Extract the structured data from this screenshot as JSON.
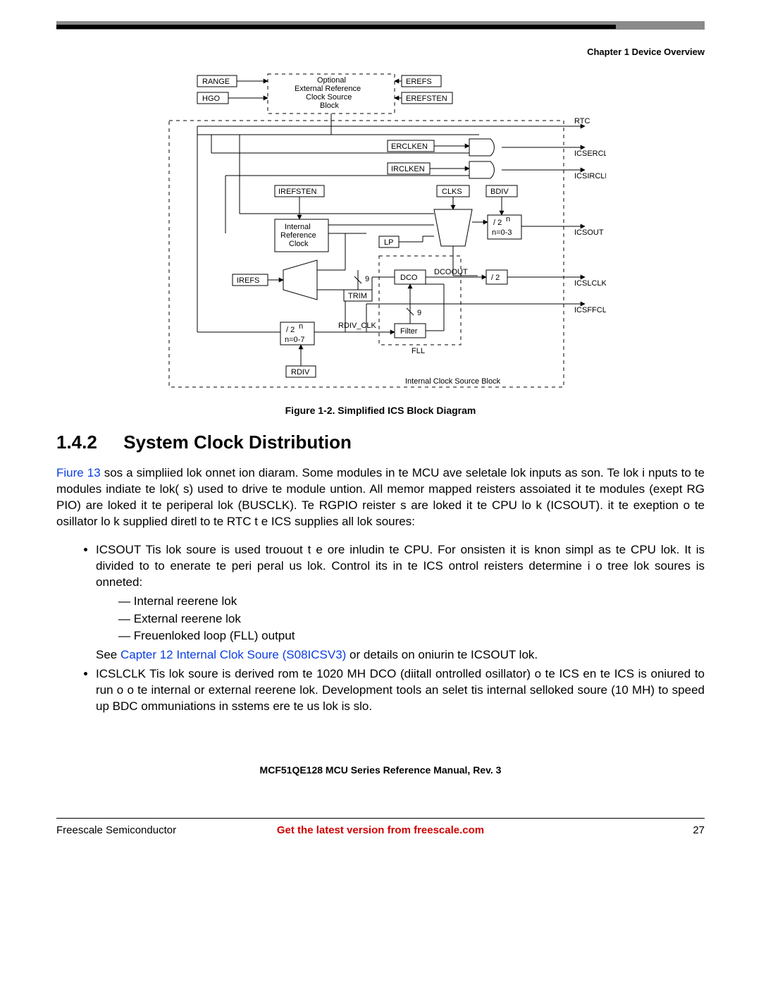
{
  "header": {
    "chapter": "Chapter 1 Device Overview"
  },
  "figure": {
    "caption": "Figure 1-2. Simplified ICS Block Diagram",
    "labels": {
      "range": "RANGE",
      "hgo": "HGO",
      "opt1": "Optional",
      "opt2": "External Reference",
      "opt3": "Clock Source",
      "opt4": "Block",
      "erefs": "EREFS",
      "erefsten": "EREFSTEN",
      "erclken": "ERCLKEN",
      "irclken": "IRCLKEN",
      "irefsten": "IREFSTEN",
      "irefs": "IREFS",
      "internal1": "Internal",
      "internal2": "Reference",
      "internal3": "Clock",
      "lp": "LP",
      "trim": "TRIM",
      "nine_a": "9",
      "nine_b": "9",
      "dco": "DCO",
      "filter": "Filter",
      "fll": "FLL",
      "dcoout": "DCOOUT",
      "clks": "CLKS",
      "bdiv": "BDIV",
      "div2n_a": "/ 2",
      "div2n_a_exp": "n",
      "n03": "n=0-3",
      "div2": "/ 2",
      "rdiv_clk": "RDIV_CLK",
      "rdiv": "RDIV",
      "div2n_b": "/ 2",
      "div2n_b_exp": "n",
      "n07": "n=0-7",
      "icsb": "Internal Clock Source Block",
      "rtc": "RTC",
      "icserclk": "ICSERCLK",
      "icsirclk": "ICSIRCLK",
      "icsout": "ICSOUT",
      "icslclk": "ICSLCLK",
      "icsffclk": "ICSFFCLK"
    }
  },
  "section": {
    "num": "1.4.2",
    "title": "System Clock Distribution",
    "p1a": "Fiure 13",
    "p1b": " sos a simpliied lok onnet ion diaram. Some modules in te MCU ave seletale lok inputs as son. Te lok i nputs to te modules indiate te lok( s) used to drive te module untion. All memor mapped reisters assoiated it te modules (exept RG PIO) are loked it te periperal lok (BUSCLK). Te RGPIO reister s are loked it te CPU lo k (ICSOUT). it te exeption o te osillator lo k supplied diretl to te RTC t e ICS supplies all lok soures:",
    "b1": "ICSOUT  Tis lok soure is used trouout t e ore inludin te CPU. For onsisten it is knon simpl as te CPU lok. It is divided to to enerate te peri peral us lok. Control its in te ICS ontrol reisters determine i o tree lok soures is onneted:",
    "d1": "Internal reerene lok",
    "d2": "External reerene lok",
    "d3": "Freuenloked loop (FLL) output",
    "b1_see_a": "See ",
    "b1_see_link": "Capter 12 Internal Clok Soure (S08ICSV3)",
    "b1_see_b": " or details on oniurin te ICSOUT lok.",
    "b2": "ICSLCLK  Tis lok soure is derived rom te 1020 MH DCO (diitall ontrolled osillator) o te ICS en te ICS is oniured to run o o te internal or external reerene lok. Development tools an selet tis internal selloked soure (10 MH) to speed up BDC ommuniations in sstems ere te us lok is slo."
  },
  "footer": {
    "manual": "MCF51QE128 MCU Series Reference Manual, Rev. 3",
    "left": "Freescale Semiconductor",
    "link": "Get the latest version from freescale.com",
    "page": "27"
  }
}
